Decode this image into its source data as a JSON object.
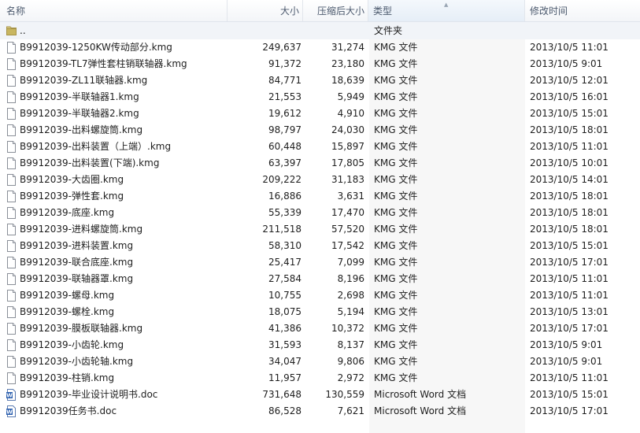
{
  "columns": {
    "name": "名称",
    "size": "大小",
    "compressed": "压缩后大小",
    "type": "类型",
    "modified": "修改时间"
  },
  "parent": {
    "name": "..",
    "type": "文件夹",
    "icon": "folder-icon"
  },
  "files": [
    {
      "name": "B9912039-1250KW传动部分.kmg",
      "size": "249,637",
      "compressed": "31,274",
      "type": "KMG 文件",
      "modified": "2013/10/5 11:01",
      "icon": "file-icon"
    },
    {
      "name": "B9912039-TL7弹性套柱销联轴器.kmg",
      "size": "91,372",
      "compressed": "23,180",
      "type": "KMG 文件",
      "modified": "2013/10/5 9:01",
      "icon": "file-icon"
    },
    {
      "name": "B9912039-ZL11联轴器.kmg",
      "size": "84,771",
      "compressed": "18,639",
      "type": "KMG 文件",
      "modified": "2013/10/5 12:01",
      "icon": "file-icon"
    },
    {
      "name": "B9912039-半联轴器1.kmg",
      "size": "21,553",
      "compressed": "5,949",
      "type": "KMG 文件",
      "modified": "2013/10/5 16:01",
      "icon": "file-icon"
    },
    {
      "name": "B9912039-半联轴器2.kmg",
      "size": "19,612",
      "compressed": "4,910",
      "type": "KMG 文件",
      "modified": "2013/10/5 15:01",
      "icon": "file-icon"
    },
    {
      "name": "B9912039-出料螺旋筒.kmg",
      "size": "98,797",
      "compressed": "24,030",
      "type": "KMG 文件",
      "modified": "2013/10/5 18:01",
      "icon": "file-icon"
    },
    {
      "name": "B9912039-出料装置（上端）.kmg",
      "size": "60,448",
      "compressed": "15,897",
      "type": "KMG 文件",
      "modified": "2013/10/5 11:01",
      "icon": "file-icon"
    },
    {
      "name": "B9912039-出料装置(下端).kmg",
      "size": "63,397",
      "compressed": "17,805",
      "type": "KMG 文件",
      "modified": "2013/10/5 10:01",
      "icon": "file-icon"
    },
    {
      "name": "B9912039-大齿圈.kmg",
      "size": "209,222",
      "compressed": "31,183",
      "type": "KMG 文件",
      "modified": "2013/10/5 14:01",
      "icon": "file-icon"
    },
    {
      "name": "B9912039-弹性套.kmg",
      "size": "16,886",
      "compressed": "3,631",
      "type": "KMG 文件",
      "modified": "2013/10/5 18:01",
      "icon": "file-icon"
    },
    {
      "name": "B9912039-底座.kmg",
      "size": "55,339",
      "compressed": "17,470",
      "type": "KMG 文件",
      "modified": "2013/10/5 18:01",
      "icon": "file-icon"
    },
    {
      "name": "B9912039-进料螺旋筒.kmg",
      "size": "211,518",
      "compressed": "57,520",
      "type": "KMG 文件",
      "modified": "2013/10/5 18:01",
      "icon": "file-icon"
    },
    {
      "name": "B9912039-进料装置.kmg",
      "size": "58,310",
      "compressed": "17,542",
      "type": "KMG 文件",
      "modified": "2013/10/5 15:01",
      "icon": "file-icon"
    },
    {
      "name": "B9912039-联合底座.kmg",
      "size": "25,417",
      "compressed": "7,099",
      "type": "KMG 文件",
      "modified": "2013/10/5 17:01",
      "icon": "file-icon"
    },
    {
      "name": "B9912039-联轴器罩.kmg",
      "size": "27,584",
      "compressed": "8,196",
      "type": "KMG 文件",
      "modified": "2013/10/5 11:01",
      "icon": "file-icon"
    },
    {
      "name": "B9912039-螺母.kmg",
      "size": "10,755",
      "compressed": "2,698",
      "type": "KMG 文件",
      "modified": "2013/10/5 11:01",
      "icon": "file-icon"
    },
    {
      "name": "B9912039-螺栓.kmg",
      "size": "18,075",
      "compressed": "5,194",
      "type": "KMG 文件",
      "modified": "2013/10/5 13:01",
      "icon": "file-icon"
    },
    {
      "name": "B9912039-膜板联轴器.kmg",
      "size": "41,386",
      "compressed": "10,372",
      "type": "KMG 文件",
      "modified": "2013/10/5 17:01",
      "icon": "file-icon"
    },
    {
      "name": "B9912039-小齿轮.kmg",
      "size": "31,593",
      "compressed": "8,137",
      "type": "KMG 文件",
      "modified": "2013/10/5 9:01",
      "icon": "file-icon"
    },
    {
      "name": "B9912039-小齿轮轴.kmg",
      "size": "34,047",
      "compressed": "9,806",
      "type": "KMG 文件",
      "modified": "2013/10/5 9:01",
      "icon": "file-icon"
    },
    {
      "name": "B9912039-柱销.kmg",
      "size": "11,957",
      "compressed": "2,972",
      "type": "KMG 文件",
      "modified": "2013/10/5 11:01",
      "icon": "file-icon"
    },
    {
      "name": "B9912039-毕业设计说明书.doc",
      "size": "731,648",
      "compressed": "130,559",
      "type": "Microsoft Word 文档",
      "modified": "2013/10/5 15:01",
      "icon": "word-doc-icon"
    },
    {
      "name": "B9912039任务书.doc",
      "size": "86,528",
      "compressed": "7,621",
      "type": "Microsoft Word 文档",
      "modified": "2013/10/5 17:01",
      "icon": "word-doc-icon"
    }
  ]
}
